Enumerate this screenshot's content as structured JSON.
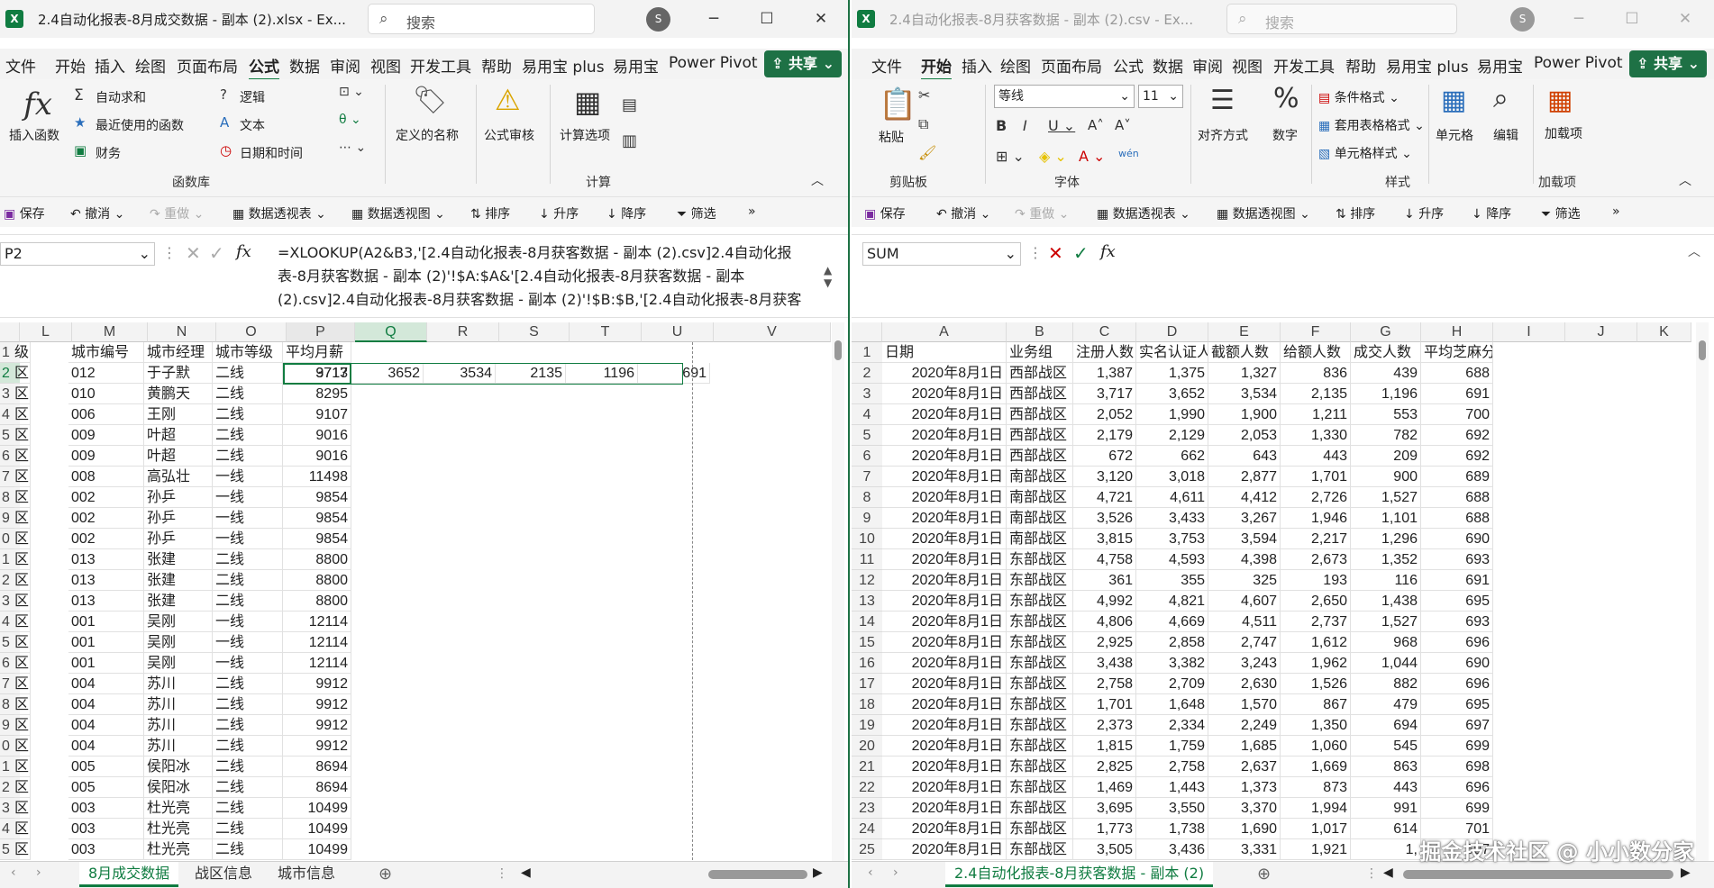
{
  "left": {
    "title": "2.4自动化报表-8月成交数据 - 副本 (2).xlsx - Ex...",
    "search_placeholder": "搜索",
    "avatar": "S",
    "tabs": [
      "文件",
      "开始",
      "插入",
      "绘图",
      "页面布局",
      "公式",
      "数据",
      "审阅",
      "视图",
      "开发工具",
      "帮助",
      "易用宝 plus",
      "易用宝",
      "Power Pivot"
    ],
    "active_tab": "公式",
    "share": "共享",
    "ribbon": {
      "insert_function": "插入函数",
      "autosum": "自动求和",
      "recent": "最近使用的函数",
      "financial": "财务",
      "logical": "逻辑",
      "text": "文本",
      "datetime": "日期和时间",
      "defined_names": "定义的名称",
      "audit": "公式审核",
      "calc_options": "计算选项",
      "group_lib": "函数库",
      "group_calc": "计算"
    },
    "qat": [
      "保存",
      "撤消",
      "重做",
      "数据透视表",
      "数据透视图",
      "排序",
      "升序",
      "降序",
      "筛选"
    ],
    "namebox": "P2",
    "formula": "=XLOOKUP(A2&B3,'[2.4自动化报表-8月获客数据 - 副本 (2).csv]2.4自动化报表-8月获客数据 - 副本 (2)'!$A:$A&'[2.4自动化报表-8月获客数据 - 副本 (2).csv]2.4自动化报表-8月获客数据 - 副本 (2)'!$B:$B,'[2.4自动化报表-8月获客",
    "columns": [
      "L",
      "M",
      "N",
      "O",
      "P",
      "Q",
      "R",
      "S",
      "T",
      "U",
      "V"
    ],
    "header_row": [
      "级",
      "城市编号",
      "城市经理",
      "城市等级",
      "平均月薪"
    ],
    "row_numbers": [
      "1",
      "2",
      "3",
      "4",
      "5",
      "6",
      "7",
      "8",
      "9",
      "0",
      "1",
      "2",
      "3",
      "4",
      "5",
      "6",
      "7",
      "8",
      "9",
      "0",
      "1",
      "2",
      "3",
      "4",
      "5"
    ],
    "rows": [
      [
        "区",
        "012",
        "于子默",
        "二线",
        "9713"
      ],
      [
        "区",
        "010",
        "黄鹏天",
        "二线",
        "8295"
      ],
      [
        "区",
        "006",
        "王刚",
        "二线",
        "9107"
      ],
      [
        "区",
        "009",
        "叶超",
        "二线",
        "9016"
      ],
      [
        "区",
        "009",
        "叶超",
        "二线",
        "9016"
      ],
      [
        "区",
        "008",
        "高弘壮",
        "一线",
        "11498"
      ],
      [
        "区",
        "002",
        "孙乒",
        "一线",
        "9854"
      ],
      [
        "区",
        "002",
        "孙乒",
        "一线",
        "9854"
      ],
      [
        "区",
        "002",
        "孙乒",
        "一线",
        "9854"
      ],
      [
        "区",
        "013",
        "张建",
        "二线",
        "8800"
      ],
      [
        "区",
        "013",
        "张建",
        "二线",
        "8800"
      ],
      [
        "区",
        "013",
        "张建",
        "二线",
        "8800"
      ],
      [
        "区",
        "001",
        "吴刚",
        "一线",
        "12114"
      ],
      [
        "区",
        "001",
        "吴刚",
        "一线",
        "12114"
      ],
      [
        "区",
        "001",
        "吴刚",
        "一线",
        "12114"
      ],
      [
        "区",
        "004",
        "苏川",
        "二线",
        "9912"
      ],
      [
        "区",
        "004",
        "苏川",
        "二线",
        "9912"
      ],
      [
        "区",
        "004",
        "苏川",
        "二线",
        "9912"
      ],
      [
        "区",
        "004",
        "苏川",
        "二线",
        "9912"
      ],
      [
        "区",
        "005",
        "侯阳冰",
        "二线",
        "8694"
      ],
      [
        "区",
        "005",
        "侯阳冰",
        "二线",
        "8694"
      ],
      [
        "区",
        "003",
        "杜光亮",
        "二线",
        "10499"
      ],
      [
        "区",
        "003",
        "杜光亮",
        "二线",
        "10499"
      ],
      [
        "区",
        "003",
        "杜光亮",
        "二线",
        "10499"
      ]
    ],
    "row2_results": [
      "3717",
      "3652",
      "3534",
      "2135",
      "1196",
      "691"
    ],
    "sheets": [
      "8月成交数据",
      "战区信息",
      "城市信息"
    ]
  },
  "right": {
    "title": "2.4自动化报表-8月获客数据 - 副本 (2).csv - Ex...",
    "search_placeholder": "搜索",
    "avatar": "S",
    "tabs": [
      "文件",
      "开始",
      "插入",
      "绘图",
      "页面布局",
      "公式",
      "数据",
      "审阅",
      "视图",
      "开发工具",
      "帮助",
      "易用宝 plus",
      "易用宝",
      "Power Pivot"
    ],
    "active_tab": "开始",
    "share": "共享",
    "ribbon": {
      "paste": "粘贴",
      "clipboard": "剪贴板",
      "font_name": "等线",
      "font_size": "11",
      "font": "字体",
      "align": "对齐方式",
      "number": "数字",
      "cond_format": "条件格式",
      "table_format": "套用表格格式",
      "cell_style": "单元格样式",
      "styles": "样式",
      "cells": "单元格",
      "edit": "编辑",
      "addin": "加载项",
      "addin_btn": "加载项"
    },
    "qat": [
      "保存",
      "撤消",
      "重做",
      "数据透视表",
      "数据透视图",
      "排序",
      "升序",
      "降序",
      "筛选"
    ],
    "namebox": "SUM",
    "formula": "",
    "columns": [
      "A",
      "B",
      "C",
      "D",
      "E",
      "F",
      "G",
      "H",
      "I",
      "J",
      "K"
    ],
    "header_row": [
      "日期",
      "业务组",
      "注册人数",
      "实名认证人数",
      "截额人数",
      "给额人数",
      "成交人数",
      "平均芝麻分"
    ],
    "rows": [
      [
        "2020年8月1日",
        "西部战区",
        "1,387",
        "1,375",
        "1,327",
        "836",
        "439",
        "688"
      ],
      [
        "2020年8月1日",
        "西部战区",
        "3,717",
        "3,652",
        "3,534",
        "2,135",
        "1,196",
        "691"
      ],
      [
        "2020年8月1日",
        "西部战区",
        "2,052",
        "1,990",
        "1,900",
        "1,211",
        "553",
        "700"
      ],
      [
        "2020年8月1日",
        "西部战区",
        "2,179",
        "2,129",
        "2,053",
        "1,330",
        "782",
        "692"
      ],
      [
        "2020年8月1日",
        "西部战区",
        "672",
        "662",
        "643",
        "443",
        "209",
        "692"
      ],
      [
        "2020年8月1日",
        "南部战区",
        "3,120",
        "3,018",
        "2,877",
        "1,701",
        "900",
        "689"
      ],
      [
        "2020年8月1日",
        "南部战区",
        "4,721",
        "4,611",
        "4,412",
        "2,726",
        "1,527",
        "688"
      ],
      [
        "2020年8月1日",
        "南部战区",
        "3,526",
        "3,433",
        "3,267",
        "1,946",
        "1,101",
        "688"
      ],
      [
        "2020年8月1日",
        "南部战区",
        "3,815",
        "3,753",
        "3,594",
        "2,217",
        "1,296",
        "690"
      ],
      [
        "2020年8月1日",
        "东部战区",
        "4,758",
        "4,593",
        "4,398",
        "2,673",
        "1,352",
        "693"
      ],
      [
        "2020年8月1日",
        "东部战区",
        "361",
        "355",
        "325",
        "193",
        "116",
        "691"
      ],
      [
        "2020年8月1日",
        "东部战区",
        "4,992",
        "4,821",
        "4,607",
        "2,650",
        "1,438",
        "695"
      ],
      [
        "2020年8月1日",
        "东部战区",
        "4,806",
        "4,669",
        "4,511",
        "2,737",
        "1,527",
        "693"
      ],
      [
        "2020年8月1日",
        "东部战区",
        "2,925",
        "2,858",
        "2,747",
        "1,612",
        "968",
        "696"
      ],
      [
        "2020年8月1日",
        "东部战区",
        "3,438",
        "3,382",
        "3,243",
        "1,962",
        "1,044",
        "690"
      ],
      [
        "2020年8月1日",
        "东部战区",
        "2,758",
        "2,709",
        "2,630",
        "1,526",
        "882",
        "696"
      ],
      [
        "2020年8月1日",
        "东部战区",
        "1,701",
        "1,648",
        "1,570",
        "867",
        "479",
        "695"
      ],
      [
        "2020年8月1日",
        "东部战区",
        "2,373",
        "2,334",
        "2,249",
        "1,350",
        "694",
        "697"
      ],
      [
        "2020年8月1日",
        "东部战区",
        "1,815",
        "1,759",
        "1,685",
        "1,060",
        "545",
        "699"
      ],
      [
        "2020年8月1日",
        "东部战区",
        "2,825",
        "2,758",
        "2,637",
        "1,669",
        "863",
        "698"
      ],
      [
        "2020年8月1日",
        "东部战区",
        "1,469",
        "1,443",
        "1,373",
        "873",
        "443",
        "696"
      ],
      [
        "2020年8月1日",
        "东部战区",
        "3,695",
        "3,550",
        "3,370",
        "1,994",
        "991",
        "699"
      ],
      [
        "2020年8月1日",
        "东部战区",
        "1,773",
        "1,738",
        "1,690",
        "1,017",
        "614",
        "701"
      ],
      [
        "2020年8月1日",
        "东部战区",
        "3,505",
        "3,436",
        "3,331",
        "1,921",
        "1,",
        "697"
      ]
    ],
    "sheets": [
      "2.4自动化报表-8月获客数据 - 副本 (2)"
    ],
    "watermark": "掘金技术社区 @ 小小数分家"
  }
}
